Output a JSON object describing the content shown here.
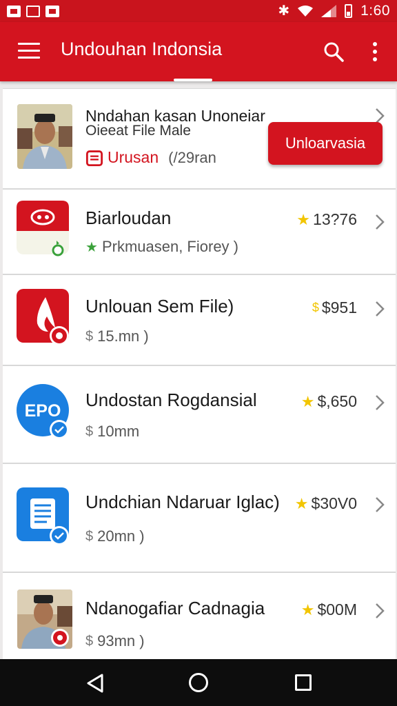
{
  "status_bar": {
    "time": "1:60"
  },
  "app_bar": {
    "title": "Undouhan Indonsia"
  },
  "featured": {
    "title_line1": "Nndahan kasan Unoneiar",
    "title_line2": "Oieeat File Male",
    "category": "Urusan",
    "meta": "(/29ran",
    "button_label": "Unloarvasia"
  },
  "items": [
    {
      "title": "Biarloudan",
      "price": "13?76",
      "subtitle": "Prkmuasen, Fiorey )",
      "icon": "red-cloud-app-icon"
    },
    {
      "title": "Unlouan Sem File)",
      "price": "$951",
      "subtitle": "15.mn )",
      "icon": "red-flame-app-icon"
    },
    {
      "title": "Undostan Rogdansial",
      "price": "$,650",
      "subtitle": "10mm",
      "icon": "epo-app-icon",
      "icon_text": "EPO"
    },
    {
      "title": "Undchian Ndaruar Iglac)",
      "price": "$30V0",
      "subtitle": "20mn )",
      "icon": "blue-document-app-icon"
    },
    {
      "title": "Ndanogafiar Cadnagia",
      "price": "$00M",
      "subtitle": "93mn )",
      "icon": "person-photo"
    }
  ],
  "colors": {
    "primary": "#d3141f",
    "star": "#f2c500",
    "blue": "#1a7fe0"
  }
}
